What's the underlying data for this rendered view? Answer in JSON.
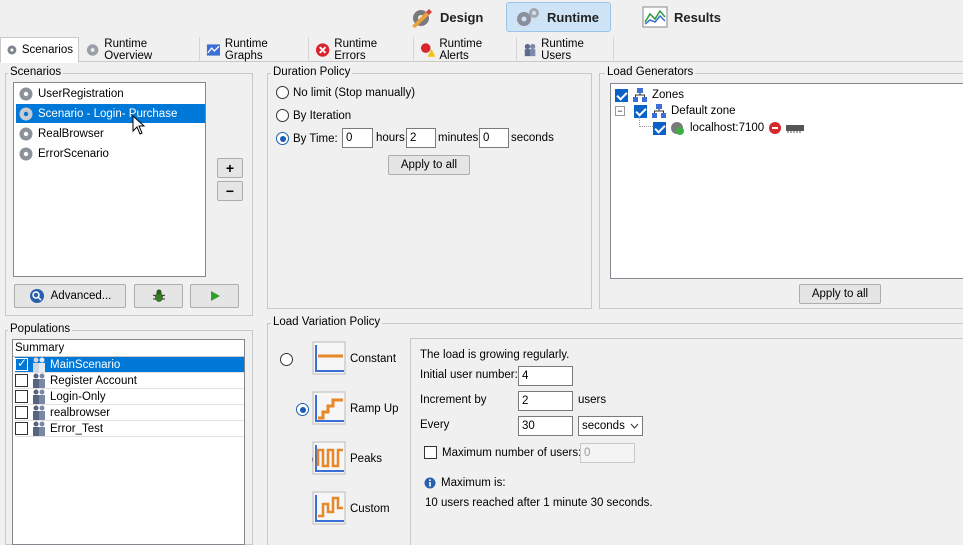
{
  "modes": [
    {
      "label": "Design",
      "icon": "design-icon"
    },
    {
      "label": "Runtime",
      "icon": "runtime-gears-icon"
    },
    {
      "label": "Results",
      "icon": "results-chart-icon"
    }
  ],
  "tabs": [
    {
      "label": "Scenarios",
      "icon": "gear-icon"
    },
    {
      "label": "Runtime Overview",
      "icon": "gear-icon"
    },
    {
      "label": "Runtime Graphs",
      "icon": "graph-icon"
    },
    {
      "label": "Runtime Errors",
      "icon": "error-icon"
    },
    {
      "label": "Runtime Alerts",
      "icon": "alert-icon"
    },
    {
      "label": "Runtime Users",
      "icon": "users-icon"
    }
  ],
  "scenarios": {
    "title": "Scenarios",
    "items": [
      "UserRegistration",
      "Scenario - Login- Purchase",
      "RealBrowser",
      "ErrorScenario"
    ],
    "selected_index": 1,
    "add_label": "+",
    "remove_label": "−",
    "advanced_label": "Advanced..."
  },
  "populations": {
    "title": "Populations",
    "header": "Summary",
    "rows": [
      {
        "label": "MainScenario",
        "checked": true
      },
      {
        "label": "Register Account",
        "checked": false
      },
      {
        "label": "Login-Only",
        "checked": false
      },
      {
        "label": "realbrowser",
        "checked": false
      },
      {
        "label": "Error_Test",
        "checked": false
      }
    ]
  },
  "duration": {
    "title": "Duration Policy",
    "no_limit": "No limit (Stop manually)",
    "by_iteration": "By Iteration",
    "by_time": "By Time:",
    "hours_value": "0",
    "hours_label": "hours",
    "minutes_value": "2",
    "minutes_label": "minutes",
    "seconds_value": "0",
    "seconds_label": "seconds",
    "apply_label": "Apply to all",
    "selected": "by_time"
  },
  "load_generators": {
    "title": "Load Generators",
    "zones_label": "Zones",
    "default_zone_label": "Default zone",
    "host_label": "localhost:7100",
    "apply_label": "Apply to all"
  },
  "load_variation": {
    "title": "Load Variation Policy",
    "options": [
      {
        "label": "Constant",
        "icon": "constant-load-icon"
      },
      {
        "label": "Ramp Up",
        "icon": "ramp-up-load-icon"
      },
      {
        "label": "Peaks",
        "icon": "peaks-load-icon"
      },
      {
        "label": "Custom",
        "icon": "custom-load-icon"
      }
    ],
    "selected_index": 1,
    "description": "The load is growing regularly.",
    "initial_label": "Initial user number:",
    "initial_value": "4",
    "increment_label": "Increment by",
    "increment_value": "2",
    "increment_unit": "users",
    "every_label": "Every",
    "every_value": "30",
    "every_unit": "seconds",
    "max_users_label": "Maximum number of users:",
    "max_users_value": "0",
    "maximum_is_label": "Maximum is:",
    "maximum_summary": "10 users reached after 1 minute 30 seconds."
  },
  "colors": {
    "selection": "#0078d7",
    "accent": "#1a5fb4",
    "active_mode": "#cfe3f7"
  }
}
